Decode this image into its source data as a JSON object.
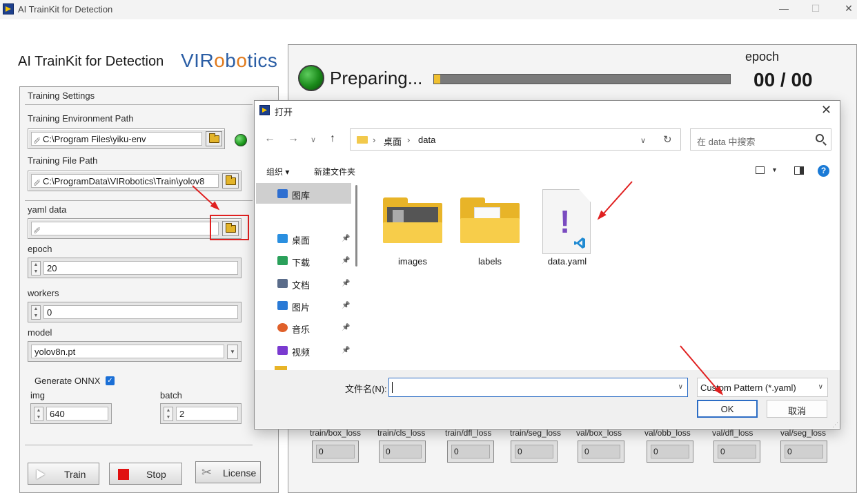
{
  "window": {
    "title": "AI TrainKit for Detection",
    "controls": [
      "—",
      "☐",
      "✕"
    ]
  },
  "app": {
    "title": "AI TrainKit for Detection",
    "brand_a": "VIR",
    "brand_o": "o",
    "brand_b": "b",
    "brand_o2": "o",
    "brand_c": "tics"
  },
  "settings": {
    "title": "Training Settings",
    "env_path_label": "Training Environment Path",
    "env_path_value": "C:\\Program Files\\yiku-env",
    "file_path_label": "Training File Path",
    "file_path_value": "C:\\ProgramData\\VIRobotics\\Train\\yolov8",
    "yaml_label": "yaml data",
    "yaml_value": "",
    "epoch_label": "epoch",
    "epoch_value": "20",
    "workers_label": "workers",
    "workers_value": "0",
    "model_label": "model",
    "model_value": "yolov8n.pt",
    "onnx_label": "Generate ONNX",
    "onnx_checked": true,
    "img_label": "img",
    "img_value": "640",
    "batch_label": "batch",
    "batch_value": "2",
    "train_button": "Train",
    "stop_button": "Stop",
    "license_button": "License"
  },
  "status": {
    "text": "Preparing...",
    "progress": 0.005,
    "epoch_label": "epoch",
    "epoch_value": "00 / 00"
  },
  "metrics": [
    {
      "label": "train/box_loss",
      "value": "0"
    },
    {
      "label": "train/cls_loss",
      "value": "0"
    },
    {
      "label": "train/dfl_loss",
      "value": "0"
    },
    {
      "label": "train/seg_loss",
      "value": "0"
    },
    {
      "label": "val/box_loss",
      "value": "0"
    },
    {
      "label": "val/obb_loss",
      "value": "0"
    },
    {
      "label": "val/dfl_loss",
      "value": "0"
    },
    {
      "label": "val/seg_loss",
      "value": "0"
    }
  ],
  "dialog": {
    "title": "打开",
    "breadcrumb": [
      "桌面",
      "data"
    ],
    "search_placeholder": "在 data 中搜索",
    "organize": "组织 ▾",
    "new_folder": "新建文件夹",
    "nav_items": [
      {
        "label": "图库",
        "pinned": false
      },
      {
        "label": "桌面",
        "pinned": true
      },
      {
        "label": "下载",
        "pinned": true
      },
      {
        "label": "文档",
        "pinned": true
      },
      {
        "label": "图片",
        "pinned": true
      },
      {
        "label": "音乐",
        "pinned": true
      },
      {
        "label": "视频",
        "pinned": true
      }
    ],
    "files": [
      {
        "name": "images",
        "type": "folder"
      },
      {
        "name": "labels",
        "type": "folder"
      },
      {
        "name": "data.yaml",
        "type": "yaml"
      }
    ],
    "filename_label": "文件名(N):",
    "filename_value": "",
    "filter": "Custom Pattern (*.yaml)",
    "ok": "OK",
    "cancel": "取消"
  },
  "colors": {
    "accent": "#2b6cc4",
    "led_green": "#1c9a1c",
    "annotation_red": "#e02020",
    "folder_yellow": "#f7cd4a"
  }
}
